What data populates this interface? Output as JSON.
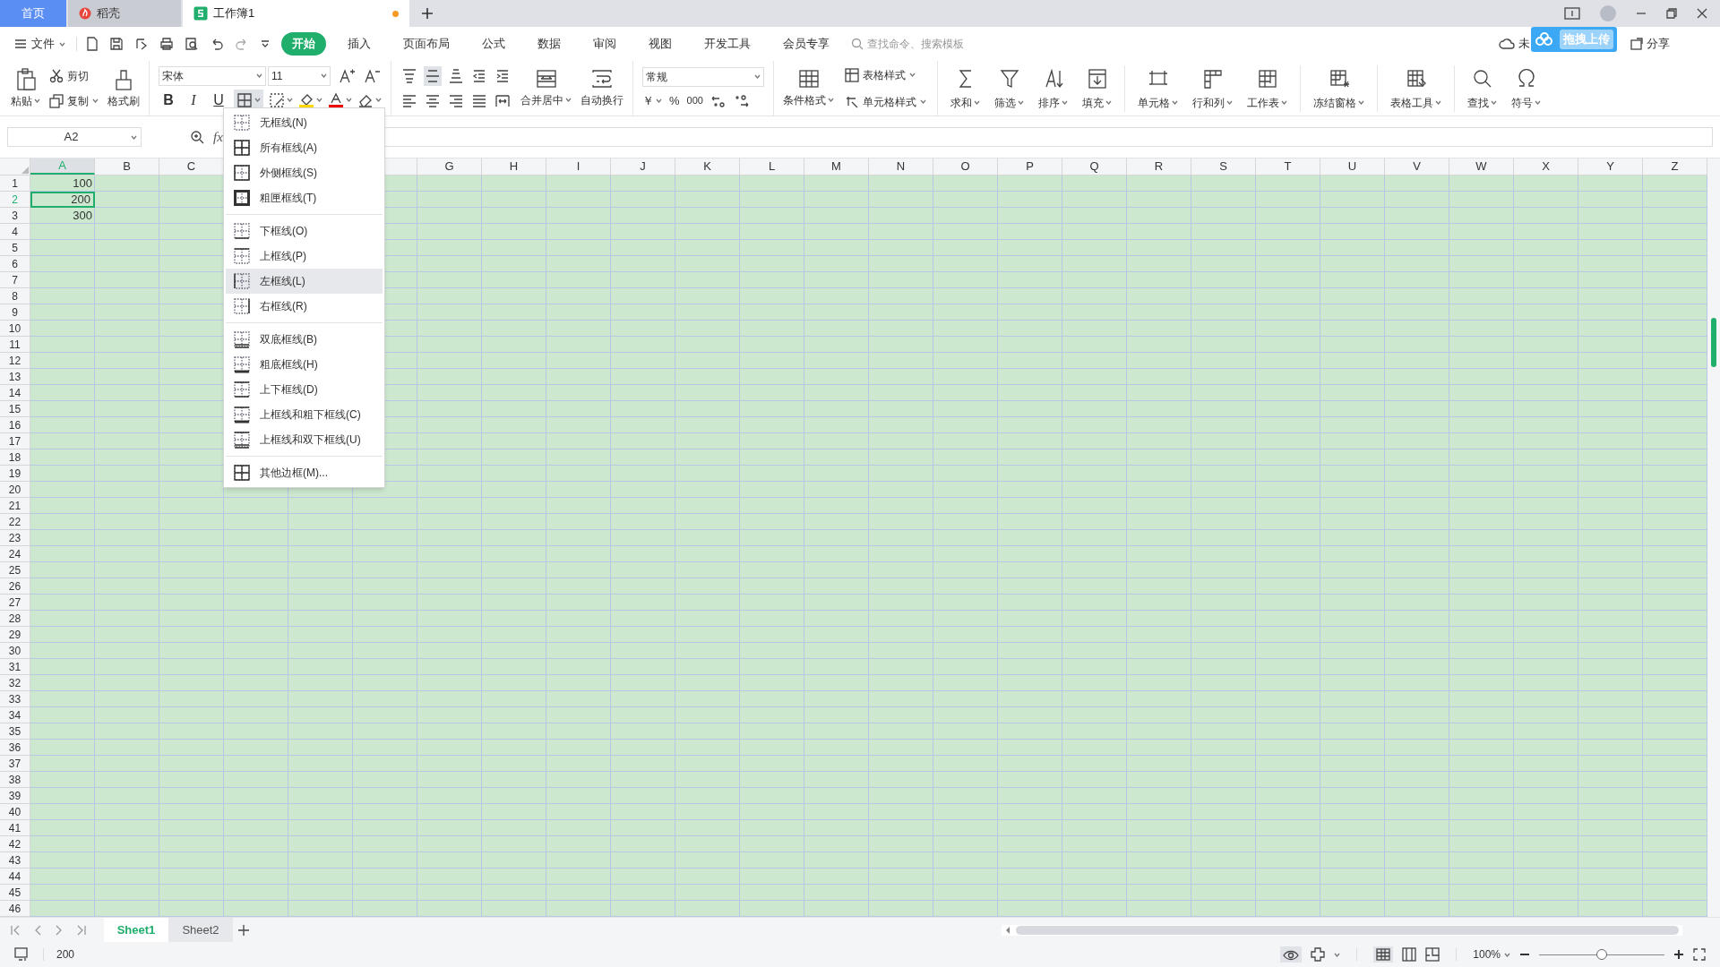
{
  "tabs": [
    {
      "label": "首页",
      "kind": "home",
      "selected": false
    },
    {
      "label": "稻壳",
      "kind": "docer",
      "selected": false
    },
    {
      "label": "工作簿1",
      "kind": "sheet",
      "selected": true
    }
  ],
  "unsaved_dot": true,
  "file_menu": "文件",
  "ribbon_tabs": [
    {
      "label": "开始",
      "selected": true
    },
    {
      "label": "插入",
      "selected": false
    },
    {
      "label": "页面布局",
      "selected": false
    },
    {
      "label": "公式",
      "selected": false
    },
    {
      "label": "数据",
      "selected": false
    },
    {
      "label": "审阅",
      "selected": false
    },
    {
      "label": "视图",
      "selected": false
    },
    {
      "label": "开发工具",
      "selected": false
    },
    {
      "label": "会员专享",
      "selected": false
    }
  ],
  "search": {
    "placeholder": "查找命令、搜索模板"
  },
  "sync_status": "未",
  "upload_badge": "拖拽上传",
  "share": "分享",
  "clipboard": {
    "paste": "粘贴",
    "cut": "剪切",
    "copy": "复制",
    "format_painter": "格式刷"
  },
  "font": {
    "name": "宋体",
    "size": "11",
    "styles": [
      "B",
      "I",
      "U"
    ],
    "border_button_selected": true
  },
  "align": [
    {
      "kind": "top",
      "selected": false
    },
    {
      "kind": "middle",
      "selected": true
    },
    {
      "kind": "bottom",
      "selected": false
    },
    {
      "kind": "outdent",
      "selected": false
    },
    {
      "kind": "indent",
      "selected": false
    },
    {
      "kind": "left",
      "selected": false
    },
    {
      "kind": "center",
      "selected": false
    },
    {
      "kind": "right",
      "selected": false
    },
    {
      "kind": "justify",
      "selected": false
    },
    {
      "kind": "distribute",
      "selected": false
    }
  ],
  "merge": "合并居中",
  "wrap": "自动换行",
  "number_format": "常规",
  "currency": "￥",
  "percent": "%",
  "thousands": "000",
  "styles": {
    "conditional": "条件格式",
    "table_style": "表格样式",
    "cell_style": "单元格样式"
  },
  "big_buttons": [
    {
      "label": "求和",
      "kind": "sum"
    },
    {
      "label": "筛选",
      "kind": "filter"
    },
    {
      "label": "排序",
      "kind": "sort"
    },
    {
      "label": "填充",
      "kind": "fill"
    },
    {
      "label": "单元格",
      "kind": "cell"
    },
    {
      "label": "行和列",
      "kind": "rowcol"
    },
    {
      "label": "工作表",
      "kind": "sheet"
    },
    {
      "label": "冻结窗格",
      "kind": "freeze"
    },
    {
      "label": "表格工具",
      "kind": "tools"
    },
    {
      "label": "查找",
      "kind": "find"
    },
    {
      "label": "符号",
      "kind": "symbol"
    }
  ],
  "name_box": "A2",
  "formula_label": "fx",
  "columns_left": [
    "A",
    "B",
    "C"
  ],
  "columns_right": [
    "G",
    "H",
    "I",
    "J",
    "K",
    "L",
    "M",
    "N",
    "O",
    "P",
    "Q",
    "R",
    "S",
    "T",
    "U",
    "V",
    "W",
    "X",
    "Y",
    "Z"
  ],
  "rows": [
    {
      "label": "1",
      "cells": [
        {
          "value": "100",
          "selected": false
        }
      ]
    },
    {
      "label": "2",
      "cells": [
        {
          "value": "200",
          "selected": true
        }
      ]
    },
    {
      "label": "3",
      "cells": [
        {
          "value": "300",
          "selected": false
        }
      ]
    },
    {
      "label": "4"
    },
    {
      "label": "5"
    },
    {
      "label": "6"
    },
    {
      "label": "7"
    },
    {
      "label": "8"
    },
    {
      "label": "9"
    },
    {
      "label": "10"
    },
    {
      "label": "11"
    },
    {
      "label": "12"
    },
    {
      "label": "13"
    },
    {
      "label": "14"
    },
    {
      "label": "15"
    },
    {
      "label": "16"
    },
    {
      "label": "17"
    },
    {
      "label": "18"
    },
    {
      "label": "19"
    },
    {
      "label": "20"
    },
    {
      "label": "21"
    },
    {
      "label": "22"
    },
    {
      "label": "23"
    },
    {
      "label": "24"
    },
    {
      "label": "25"
    },
    {
      "label": "26"
    },
    {
      "label": "27"
    },
    {
      "label": "28"
    },
    {
      "label": "29"
    },
    {
      "label": "30"
    },
    {
      "label": "31"
    },
    {
      "label": "32"
    },
    {
      "label": "33"
    },
    {
      "label": "34"
    },
    {
      "label": "35"
    },
    {
      "label": "36"
    },
    {
      "label": "37"
    },
    {
      "label": "38"
    },
    {
      "label": "39"
    },
    {
      "label": "40"
    },
    {
      "label": "41"
    },
    {
      "label": "42"
    },
    {
      "label": "43"
    },
    {
      "label": "44"
    },
    {
      "label": "45"
    },
    {
      "label": "46"
    }
  ],
  "border_menu": [
    [
      {
        "label": "无框线(N)",
        "kind": "none",
        "selected": false
      },
      {
        "label": "所有框线(A)",
        "kind": "all",
        "selected": false
      },
      {
        "label": "外侧框线(S)",
        "kind": "outside",
        "selected": false
      },
      {
        "label": "粗匣框线(T)",
        "kind": "thickbox",
        "selected": false
      }
    ],
    [
      {
        "label": "下框线(O)",
        "kind": "bottom",
        "selected": false
      },
      {
        "label": "上框线(P)",
        "kind": "top",
        "selected": false
      },
      {
        "label": "左框线(L)",
        "kind": "left",
        "selected": true
      },
      {
        "label": "右框线(R)",
        "kind": "right",
        "selected": false
      }
    ],
    [
      {
        "label": "双底框线(B)",
        "kind": "double",
        "selected": false
      },
      {
        "label": "粗底框线(H)",
        "kind": "thickbottom",
        "selected": false
      },
      {
        "label": "上下框线(D)",
        "kind": "topbottom",
        "selected": false
      },
      {
        "label": "上框线和粗下框线(C)",
        "kind": "topthick",
        "selected": false
      },
      {
        "label": "上框线和双下框线(U)",
        "kind": "topdouble",
        "selected": false
      }
    ],
    [
      {
        "label": "其他边框(M)...",
        "kind": "more",
        "selected": false
      }
    ]
  ],
  "sheets": [
    {
      "label": "Sheet1",
      "selected": true
    },
    {
      "label": "Sheet2",
      "selected": false
    }
  ],
  "status_value": "200",
  "zoom": {
    "label": "100%",
    "level": 0.5
  }
}
